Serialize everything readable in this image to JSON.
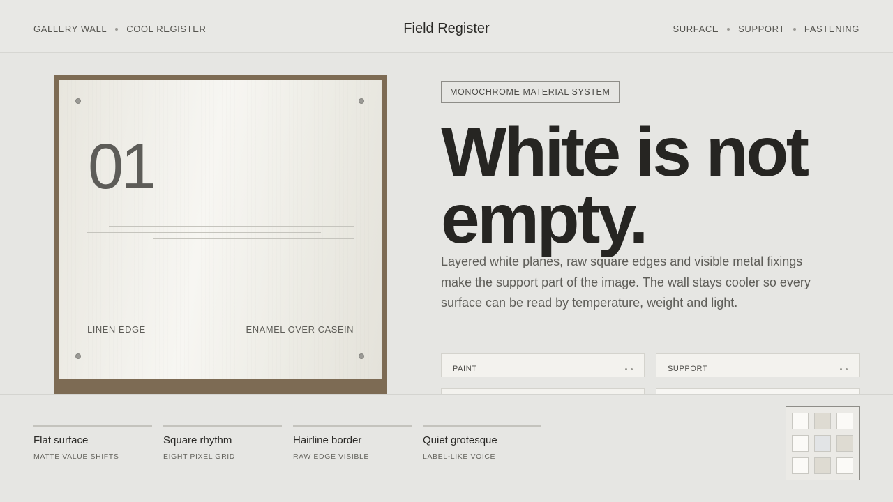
{
  "header": {
    "nav_left": [
      "GALLERY WALL",
      "COOL REGISTER"
    ],
    "title": "Field Register",
    "nav_right": [
      "SURFACE",
      "SUPPORT",
      "FASTENING"
    ]
  },
  "hero": {
    "number": "01",
    "label_left": "LINEN EDGE",
    "label_right": "ENAMEL OVER CASEIN"
  },
  "intro": {
    "badge": "MONOCHROME MATERIAL SYSTEM",
    "headline_line1": "White is not",
    "headline_line2": "empty.",
    "lead": "Layered white planes, raw square edges and visible metal fixings make the support part of the image. The wall stays cooler so every surface can be read by temperature, weight and light."
  },
  "cards": [
    {
      "label": "PAINT"
    },
    {
      "label": "SUPPORT"
    }
  ],
  "features": [
    {
      "title": "Flat surface",
      "sub": "MATTE VALUE SHIFTS"
    },
    {
      "title": "Square rhythm",
      "sub": "EIGHT PIXEL GRID"
    },
    {
      "title": "Hairline border",
      "sub": "RAW EDGE VISIBLE"
    },
    {
      "title": "Quiet grotesque",
      "sub": "LABEL-LIKE VOICE"
    }
  ],
  "swatches": [
    "#fbfaf7",
    "#dedbd2",
    "#fbfaf7",
    "#fbfaf7",
    "#e2e4e6",
    "#dedbd2",
    "#fbfaf7",
    "#dedbd2",
    "#fbfaf7"
  ],
  "colors": {
    "frame": "#7d6b54",
    "background": "#e6e6e3",
    "ink": "#262522"
  }
}
